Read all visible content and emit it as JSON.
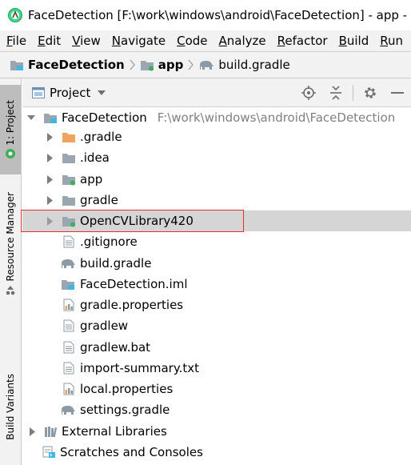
{
  "window": {
    "title": "FaceDetection [F:\\work\\windows\\android\\FaceDetection] - app - Android Studio"
  },
  "menu": [
    {
      "label": "File",
      "mnemonic": "F",
      "rest": "ile"
    },
    {
      "label": "Edit",
      "mnemonic": "E",
      "rest": "dit"
    },
    {
      "label": "View",
      "mnemonic": "V",
      "rest": "iew"
    },
    {
      "label": "Navigate",
      "mnemonic": "N",
      "rest": "avigate"
    },
    {
      "label": "Code",
      "mnemonic": "C",
      "rest": "ode"
    },
    {
      "label": "Analyze",
      "mnemonic": "A",
      "rest": "nalyze"
    },
    {
      "label": "Refactor",
      "mnemonic": "R",
      "rest": "efactor"
    },
    {
      "label": "Build",
      "mnemonic": "B",
      "rest": "uild"
    },
    {
      "label": "Run",
      "mnemonic": "R",
      "rest": "un"
    }
  ],
  "breadcrumb": [
    {
      "label": "FaceDetection",
      "icon": "project-folder-icon"
    },
    {
      "label": "app",
      "icon": "module-folder-icon"
    },
    {
      "label": "build.gradle",
      "icon": "gradle-elephant-icon"
    }
  ],
  "left_strip": {
    "project_tab": "1: Project",
    "resource_tab": "Resource Manager",
    "build_variants_tab": "Build Variants"
  },
  "panel": {
    "title": "Project"
  },
  "tree": {
    "root": {
      "label": "FaceDetection",
      "path": "F:\\work\\windows\\android\\FaceDetection"
    },
    "items": [
      {
        "label": ".gradle",
        "icon": "orange-folder-icon"
      },
      {
        "label": ".idea",
        "icon": "folder-icon"
      },
      {
        "label": "app",
        "icon": "module-folder-icon"
      },
      {
        "label": "gradle",
        "icon": "folder-icon"
      },
      {
        "label": "OpenCVLibrary420",
        "icon": "module-folder-icon"
      },
      {
        "label": ".gitignore",
        "icon": "text-file-icon"
      },
      {
        "label": "build.gradle",
        "icon": "gradle-elephant-icon"
      },
      {
        "label": "FaceDetection.iml",
        "icon": "iml-file-icon"
      },
      {
        "label": "gradle.properties",
        "icon": "properties-file-icon"
      },
      {
        "label": "gradlew",
        "icon": "text-file-icon"
      },
      {
        "label": "gradlew.bat",
        "icon": "text-file-icon"
      },
      {
        "label": "import-summary.txt",
        "icon": "text-file-icon"
      },
      {
        "label": "local.properties",
        "icon": "properties-file-icon"
      },
      {
        "label": "settings.gradle",
        "icon": "gradle-elephant-icon"
      }
    ],
    "external_libraries": "External Libraries",
    "scratches": "Scratches and Consoles"
  }
}
